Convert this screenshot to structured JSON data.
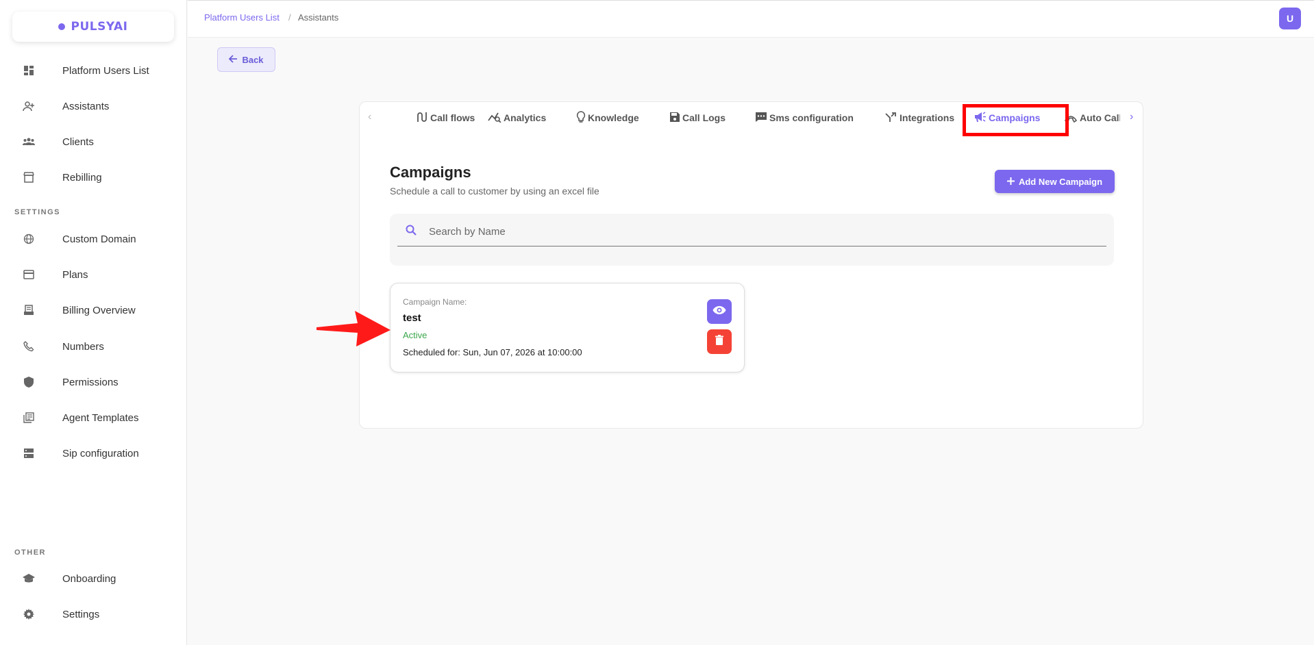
{
  "app": {
    "brand": "PULSYAI"
  },
  "sidebar": {
    "items": [
      {
        "label": "Platform Users List",
        "icon": "dashboard-icon"
      },
      {
        "label": "Assistants",
        "icon": "person-add-icon"
      },
      {
        "label": "Clients",
        "icon": "group-icon"
      },
      {
        "label": "Rebilling",
        "icon": "store-icon"
      }
    ],
    "settings_label": "SETTINGS",
    "settings_items": [
      {
        "label": "Custom Domain",
        "icon": "globe-icon"
      },
      {
        "label": "Plans",
        "icon": "credit-card-icon"
      },
      {
        "label": "Billing Overview",
        "icon": "receipt-icon"
      },
      {
        "label": "Numbers",
        "icon": "phone-icon"
      },
      {
        "label": "Permissions",
        "icon": "shield-icon"
      },
      {
        "label": "Agent Templates",
        "icon": "library-icon"
      },
      {
        "label": "Sip configuration",
        "icon": "server-icon"
      }
    ],
    "other_label": "OTHER",
    "other_items": [
      {
        "label": "Onboarding",
        "icon": "school-icon"
      },
      {
        "label": "Settings",
        "icon": "gear-icon"
      }
    ]
  },
  "breadcrumb": {
    "parent": "Platform Users List",
    "separator": "/",
    "current": "Assistants"
  },
  "user": {
    "avatar_initial": "U"
  },
  "back_label": "Back",
  "tabs": [
    {
      "label": "Call flows",
      "icon": "call-flow-icon"
    },
    {
      "label": "Analytics",
      "icon": "analytics-icon"
    },
    {
      "label": "Knowledge",
      "icon": "lightbulb-icon"
    },
    {
      "label": "Call Logs",
      "icon": "save-icon"
    },
    {
      "label": "Sms configuration",
      "icon": "sms-icon"
    },
    {
      "label": "Integrations",
      "icon": "merge-icon"
    },
    {
      "label": "Campaigns",
      "icon": "campaign-icon",
      "active": true
    },
    {
      "label": "Auto Call",
      "icon": "auto-call-icon"
    }
  ],
  "campaigns": {
    "title": "Campaigns",
    "subtitle": "Schedule a call to customer by using an excel file",
    "add_button": "Add New Campaign",
    "search_placeholder": "Search by Name",
    "items": [
      {
        "label": "Campaign Name:",
        "name": "test",
        "status": "Active",
        "scheduled": "Scheduled for: Sun, Jun 07, 2026 at 10:00:00"
      }
    ]
  },
  "colors": {
    "accent": "#7b68ee",
    "danger": "#f44336",
    "success": "#3aa64a",
    "annotation": "#ff0000"
  }
}
